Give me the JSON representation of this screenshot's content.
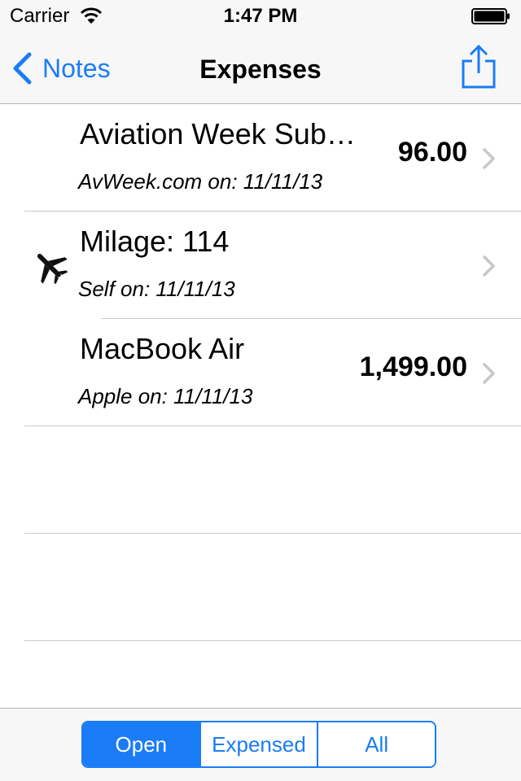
{
  "status_bar": {
    "carrier": "Carrier",
    "time": "1:47 PM"
  },
  "nav": {
    "back_label": "Notes",
    "title": "Expenses"
  },
  "rows": [
    {
      "title": "Aviation Week Sub…",
      "subtitle": "AvWeek.com on: 11/11/13",
      "amount": "96.00",
      "icon": ""
    },
    {
      "title": "Milage:  114",
      "subtitle": "Self on: 11/11/13",
      "amount": "",
      "icon": "airplane-icon"
    },
    {
      "title": "MacBook Air",
      "subtitle": "Apple on: 11/11/13",
      "amount": "1,499.00",
      "icon": ""
    }
  ],
  "segments": [
    {
      "label": "Open",
      "selected": true
    },
    {
      "label": "Expensed",
      "selected": false
    },
    {
      "label": "All",
      "selected": false
    }
  ],
  "colors": {
    "accent": "#1a7cf7",
    "bar_background": "#f7f7f7",
    "separator": "#c8c7cc"
  }
}
